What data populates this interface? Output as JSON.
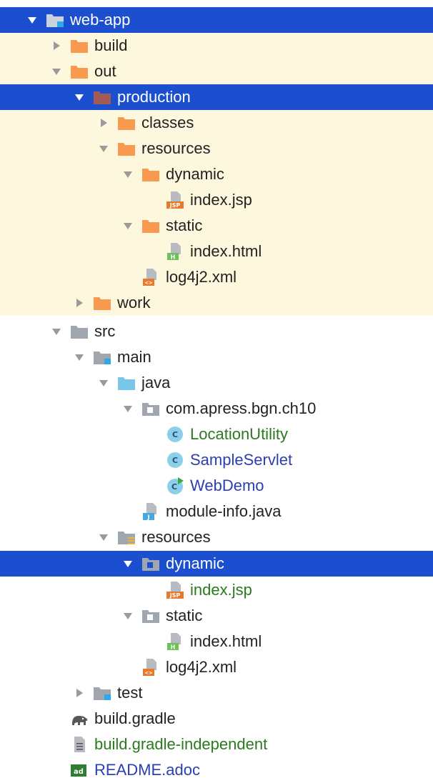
{
  "tree": {
    "items": [
      {
        "name": "web-app",
        "icon": "module-folder-icon",
        "expanded": true,
        "highlight": "selected",
        "text_color": "default"
      },
      {
        "name": "build",
        "icon": "folder-orange-icon",
        "expanded": false,
        "highlight": "excluded",
        "text_color": "default"
      },
      {
        "name": "out",
        "icon": "folder-orange-icon",
        "expanded": true,
        "highlight": "excluded",
        "text_color": "default"
      },
      {
        "name": "production",
        "icon": "folder-orange-icon",
        "expanded": true,
        "highlight": "selected",
        "text_color": "default"
      },
      {
        "name": "classes",
        "icon": "folder-orange-icon",
        "expanded": false,
        "highlight": "excluded",
        "text_color": "default"
      },
      {
        "name": "resources",
        "icon": "folder-orange-icon",
        "expanded": true,
        "highlight": "excluded",
        "text_color": "default"
      },
      {
        "name": "dynamic",
        "icon": "folder-orange-icon",
        "expanded": true,
        "highlight": "excluded",
        "text_color": "default"
      },
      {
        "name": "index.jsp",
        "icon": "jsp-file-icon",
        "highlight": "excluded",
        "text_color": "default"
      },
      {
        "name": "static",
        "icon": "folder-orange-icon",
        "expanded": true,
        "highlight": "excluded",
        "text_color": "default"
      },
      {
        "name": "index.html",
        "icon": "html-file-icon",
        "highlight": "excluded",
        "text_color": "default"
      },
      {
        "name": "log4j2.xml",
        "icon": "xml-file-icon",
        "highlight": "excluded",
        "text_color": "default"
      },
      {
        "name": "work",
        "icon": "folder-orange-icon",
        "expanded": false,
        "highlight": "excluded",
        "text_color": "default"
      },
      {
        "name": "src",
        "icon": "folder-gray-icon",
        "expanded": true,
        "highlight": "none",
        "text_color": "default"
      },
      {
        "name": "main",
        "icon": "source-root-folder-icon",
        "expanded": true,
        "highlight": "none",
        "text_color": "default"
      },
      {
        "name": "java",
        "icon": "folder-blue-icon",
        "expanded": true,
        "highlight": "none",
        "text_color": "default"
      },
      {
        "name": "com.apress.bgn.ch10",
        "icon": "package-icon",
        "expanded": true,
        "highlight": "none",
        "text_color": "default"
      },
      {
        "name": "LocationUtility",
        "icon": "class-icon",
        "highlight": "none",
        "text_color": "green"
      },
      {
        "name": "SampleServlet",
        "icon": "class-icon",
        "highlight": "none",
        "text_color": "blue"
      },
      {
        "name": "WebDemo",
        "icon": "runnable-class-icon",
        "highlight": "none",
        "text_color": "blue"
      },
      {
        "name": "module-info.java",
        "icon": "java-file-icon",
        "highlight": "none",
        "text_color": "default"
      },
      {
        "name": "resources",
        "icon": "resources-folder-icon",
        "expanded": true,
        "highlight": "none",
        "text_color": "default"
      },
      {
        "name": "dynamic",
        "icon": "package-icon",
        "expanded": true,
        "highlight": "selected",
        "text_color": "default"
      },
      {
        "name": "index.jsp",
        "icon": "jsp-file-icon",
        "highlight": "none",
        "text_color": "green"
      },
      {
        "name": "static",
        "icon": "package-icon",
        "expanded": true,
        "highlight": "none",
        "text_color": "default"
      },
      {
        "name": "index.html",
        "icon": "html-file-icon",
        "highlight": "none",
        "text_color": "default"
      },
      {
        "name": "log4j2.xml",
        "icon": "xml-file-icon",
        "highlight": "none",
        "text_color": "default"
      },
      {
        "name": "test",
        "icon": "source-root-folder-icon",
        "expanded": false,
        "highlight": "none",
        "text_color": "default"
      },
      {
        "name": "build.gradle",
        "icon": "gradle-elephant-icon",
        "highlight": "none",
        "text_color": "default"
      },
      {
        "name": "build.gradle-independent",
        "icon": "text-file-icon",
        "highlight": "none",
        "text_color": "green"
      },
      {
        "name": "README.adoc",
        "icon": "asciidoc-file-icon",
        "highlight": "none",
        "text_color": "blue"
      }
    ]
  },
  "colors": {
    "selection_bg": "#1c4fd0",
    "excluded_bg": "#fdf8dd",
    "folder_orange": "#f79a4f",
    "folder_gray": "#a0a6ae",
    "folder_blue": "#78c6e8",
    "folder_dark_red": "#a45a56",
    "text_green": "#2a7a1e",
    "text_blue": "#2b3fb0"
  }
}
